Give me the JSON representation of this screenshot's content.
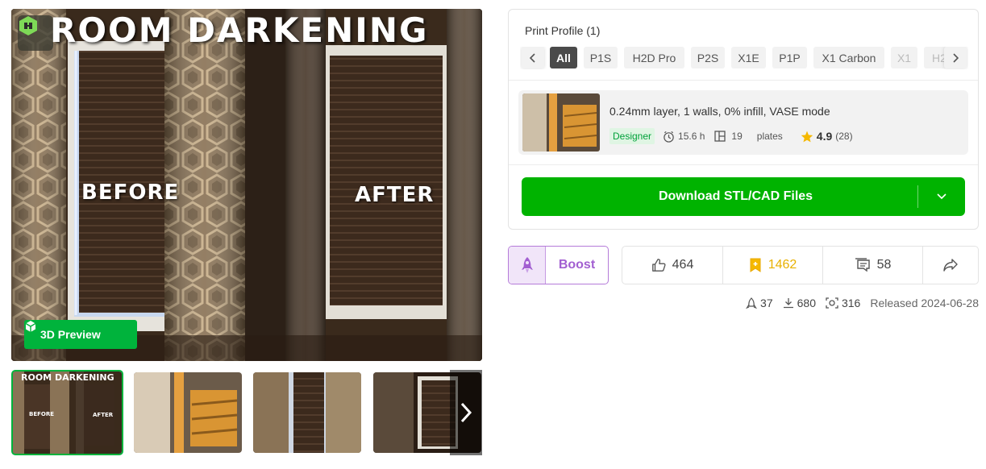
{
  "hero": {
    "title": "ROOM DARKENING",
    "before_label": "BEFORE",
    "after_label": "AFTER",
    "preview_button": "3D Preview"
  },
  "thumbnails": [
    {
      "title": "ROOM DARKENING",
      "before": "BEFORE",
      "after": "AFTER"
    },
    {},
    {},
    {}
  ],
  "print_profile": {
    "title": "Print Profile (1)",
    "printers": [
      "All",
      "P1S",
      "H2D Pro",
      "P2S",
      "X1E",
      "P1P",
      "X1 Carbon",
      "X1",
      "H2"
    ],
    "selected": "All",
    "profile": {
      "name": "0.24mm layer, 1 walls, 0% infill, VASE mode",
      "badge": "Designer",
      "time": "15.6 h",
      "plates_count": "19",
      "plates_label": "plates",
      "rating": "4.9",
      "rating_count": "(28)"
    },
    "download_label": "Download STL/CAD Files"
  },
  "actions": {
    "boost": "Boost",
    "likes": "464",
    "collects": "1462",
    "comments": "58"
  },
  "stats": {
    "boosts": "37",
    "downloads": "680",
    "prints": "316",
    "released": "Released 2024-06-28"
  },
  "colors": {
    "accent_green": "#00b300",
    "boost_purple": "#a25fd1",
    "collect_yellow": "#e8b100"
  }
}
